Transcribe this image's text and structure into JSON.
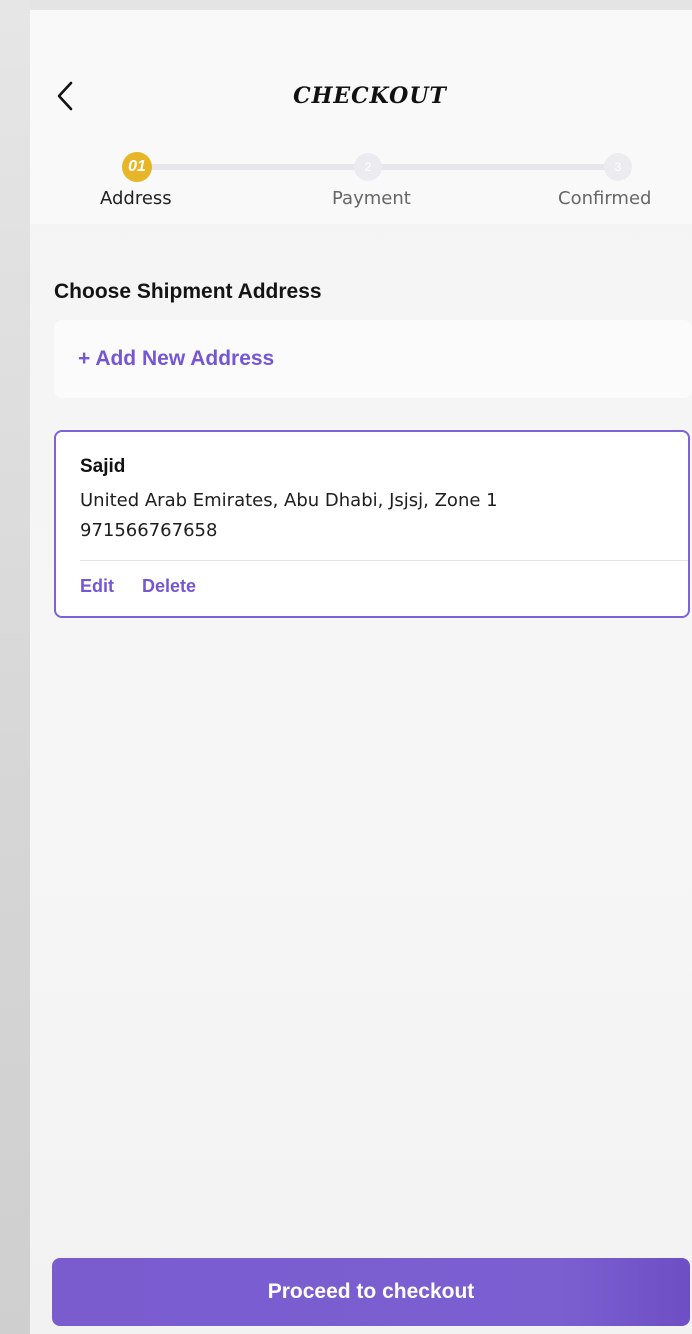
{
  "header": {
    "back_icon": "chevron-left-icon",
    "title": "CHECKOUT"
  },
  "stepper": {
    "steps": [
      {
        "number": "01",
        "label": "Address",
        "state": "active"
      },
      {
        "number": "2",
        "label": "Payment",
        "state": "inactive"
      },
      {
        "number": "3",
        "label": "Confirmed",
        "state": "inactive"
      }
    ]
  },
  "main": {
    "section_title": "Choose Shipment Address",
    "add_address_label": "+ Add New Address",
    "address": {
      "name": "Sajid",
      "line1": "United Arab Emirates, Abu Dhabi, Jsjsj, Zone 1",
      "phone": "971566767658",
      "edit_label": "Edit",
      "delete_label": "Delete"
    }
  },
  "footer": {
    "proceed_label": "Proceed to checkout"
  },
  "colors": {
    "accent": "#7556d3",
    "step_active": "#e6b628",
    "button": "#7a5ccf"
  }
}
